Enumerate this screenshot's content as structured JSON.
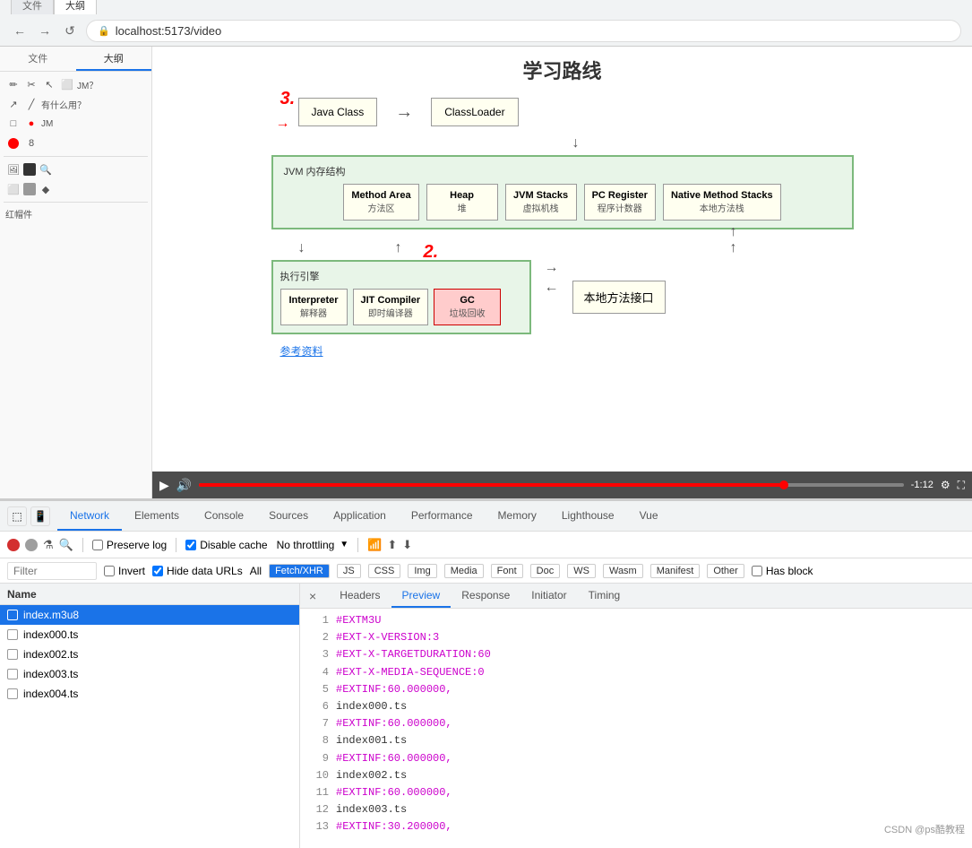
{
  "browser": {
    "back_label": "←",
    "forward_label": "→",
    "refresh_label": "↺",
    "url": "localhost:5173/video",
    "tabs": [
      {
        "label": "文件",
        "active": false
      },
      {
        "label": "大纲",
        "active": true
      }
    ]
  },
  "sidebar": {
    "tools": [
      {
        "icon": "✏️",
        "label": ""
      },
      {
        "icon": "✂️",
        "label": ""
      },
      {
        "icon": "🔲",
        "label": ""
      }
    ],
    "text_label": "有什么用？",
    "redhat_label": "红帽件"
  },
  "diagram": {
    "title": "学习路线",
    "annotation_3": "3.",
    "annotation_2": "2.",
    "java_class_label": "Java Class",
    "classloader_label": "ClassLoader",
    "jvm_title": "JVM 内存结构",
    "jvm_boxes": [
      {
        "title": "Method Area",
        "sub": "方法区"
      },
      {
        "title": "Heap",
        "sub": "堆"
      },
      {
        "title": "JVM Stacks",
        "sub": "虚拟机栈"
      },
      {
        "title": "PC Register",
        "sub": "程序计数器"
      },
      {
        "title": "Native Method Stacks",
        "sub": "本地方法栈"
      }
    ],
    "exec_title": "执行引擎",
    "exec_boxes": [
      {
        "title": "Interpreter",
        "sub": "解释器",
        "highlighted": false
      },
      {
        "title": "JIT Compiler",
        "sub": "即时编译器",
        "highlighted": false
      },
      {
        "title": "GC",
        "sub": "垃圾回收",
        "highlighted": true
      }
    ],
    "native_label": "本地方法接口",
    "ref_link": "参考资料"
  },
  "video_controls": {
    "play_icon": "▶",
    "volume_icon": "🔊",
    "time": "-1:12",
    "fullscreen_icon": "⛶",
    "settings_icon": "⚙"
  },
  "devtools": {
    "tabs": [
      {
        "label": "Network",
        "active": true
      },
      {
        "label": "Elements",
        "active": false
      },
      {
        "label": "Console",
        "active": false
      },
      {
        "label": "Sources",
        "active": false
      },
      {
        "label": "Application",
        "active": false
      },
      {
        "label": "Performance",
        "active": false
      },
      {
        "label": "Memory",
        "active": false
      },
      {
        "label": "Lighthouse",
        "active": false
      },
      {
        "label": "Vue",
        "active": false
      }
    ],
    "toolbar": {
      "preserve_log_label": "Preserve log",
      "disable_cache_label": "Disable cache",
      "throttle_label": "No throttling"
    },
    "filter": {
      "placeholder": "Filter",
      "invert_label": "Invert",
      "hide_data_urls_label": "Hide data URLs",
      "all_label": "All",
      "fetch_xhr_label": "Fetch/XHR",
      "js_label": "JS",
      "css_label": "CSS",
      "img_label": "Img",
      "media_label": "Media",
      "font_label": "Font",
      "doc_label": "Doc",
      "ws_label": "WS",
      "wasm_label": "Wasm",
      "manifest_label": "Manifest",
      "other_label": "Other",
      "has_block_label": "Has block"
    },
    "network_list": {
      "header": "Name",
      "rows": [
        {
          "name": "index.m3u8",
          "selected": true
        },
        {
          "name": "index000.ts",
          "selected": false
        },
        {
          "name": "index002.ts",
          "selected": false
        },
        {
          "name": "index003.ts",
          "selected": false
        },
        {
          "name": "index004.ts",
          "selected": false
        }
      ]
    },
    "response_panel": {
      "tabs": [
        "Headers",
        "Preview",
        "Response",
        "Initiator",
        "Timing"
      ],
      "active_tab": "Preview",
      "close_icon": "×",
      "content_lines": [
        {
          "num": 1,
          "code": "#EXTM3U"
        },
        {
          "num": 2,
          "code": "#EXT-X-VERSION:3"
        },
        {
          "num": 3,
          "code": "#EXT-X-TARGETDURATION:60"
        },
        {
          "num": 4,
          "code": "#EXT-X-MEDIA-SEQUENCE:0"
        },
        {
          "num": 5,
          "code": "#EXTINF:60.000000,"
        },
        {
          "num": 6,
          "code": "index000.ts"
        },
        {
          "num": 7,
          "code": "#EXTINF:60.000000,"
        },
        {
          "num": 8,
          "code": "index001.ts"
        },
        {
          "num": 9,
          "code": "#EXTINF:60.000000,"
        },
        {
          "num": 10,
          "code": "index002.ts"
        },
        {
          "num": 11,
          "code": "#EXTINF:60.000000,"
        },
        {
          "num": 12,
          "code": "index003.ts"
        },
        {
          "num": 13,
          "code": "#EXTINF:30.200000,"
        }
      ]
    }
  },
  "watermark": {
    "text": "CSDN @ps酷教程"
  }
}
